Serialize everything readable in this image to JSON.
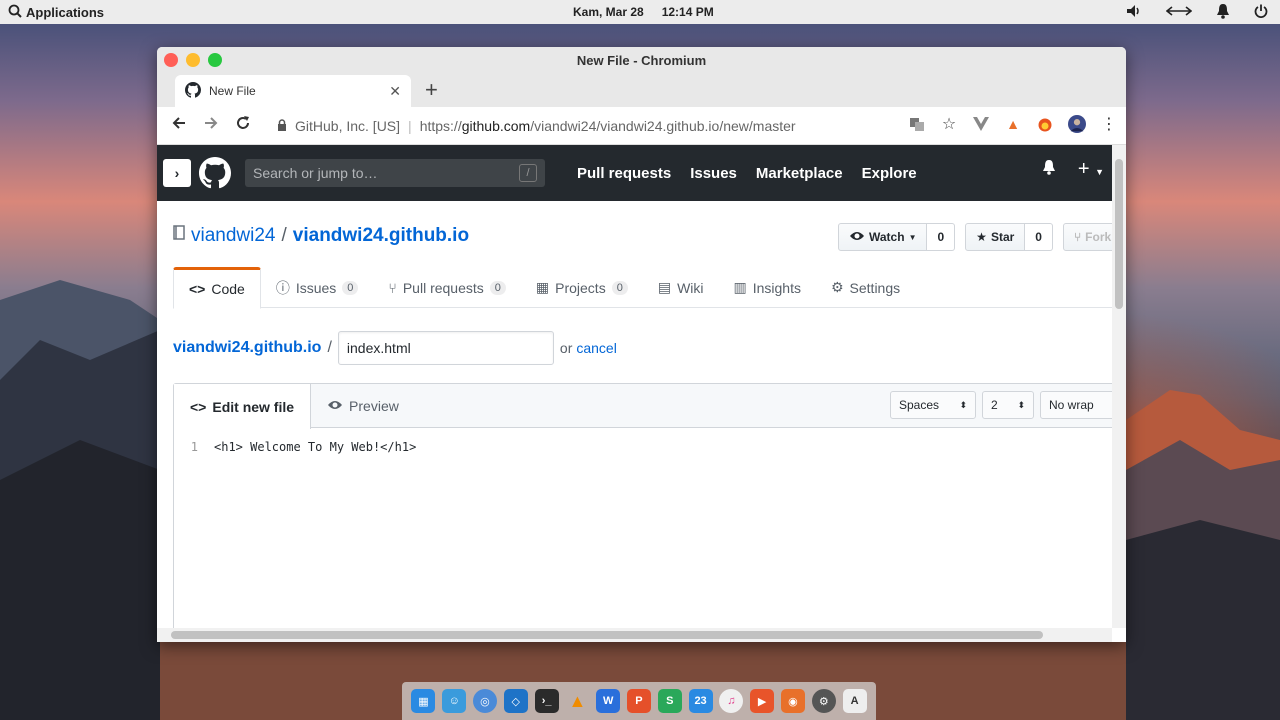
{
  "top_panel": {
    "applications_label": "Applications",
    "date": "Kam, Mar 28",
    "time": "12:14 PM"
  },
  "window": {
    "title": "New File - Chromium",
    "tab_title": "New File",
    "new_tab_symbol": "+"
  },
  "omnibox": {
    "security_label": "GitHub, Inc. [US]",
    "url_scheme": "https://",
    "url_host": "github.com",
    "url_path": "/viandwi24/viandwi24.github.io/new/master"
  },
  "github": {
    "search_placeholder": "Search or jump to…",
    "search_shortcut": "/",
    "nav": [
      "Pull requests",
      "Issues",
      "Marketplace",
      "Explore"
    ],
    "repo_owner": "viandwi24",
    "repo_name": "viandwi24.github.io",
    "watch_label": "Watch",
    "watch_count": "0",
    "star_label": "Star",
    "star_count": "0",
    "fork_label": "Fork",
    "tabs": {
      "code": "Code",
      "issues": "Issues",
      "issues_count": "0",
      "pulls": "Pull requests",
      "pulls_count": "0",
      "projects": "Projects",
      "projects_count": "0",
      "wiki": "Wiki",
      "insights": "Insights",
      "settings": "Settings"
    },
    "breadcrumb_root": "viandwi24.github.io",
    "breadcrumb_sep": "/",
    "filename_value": "index.html",
    "or_label": "or",
    "cancel_label": "cancel",
    "editor": {
      "edit_tab": "Edit new file",
      "preview_tab": "Preview",
      "indent_mode": "Spaces",
      "indent_size": "2",
      "wrap_mode": "No wrap",
      "line_number": "1",
      "line_content": "<h1> Welcome To My Web!</h1>"
    }
  },
  "dock": {
    "calendar_label": "23"
  }
}
